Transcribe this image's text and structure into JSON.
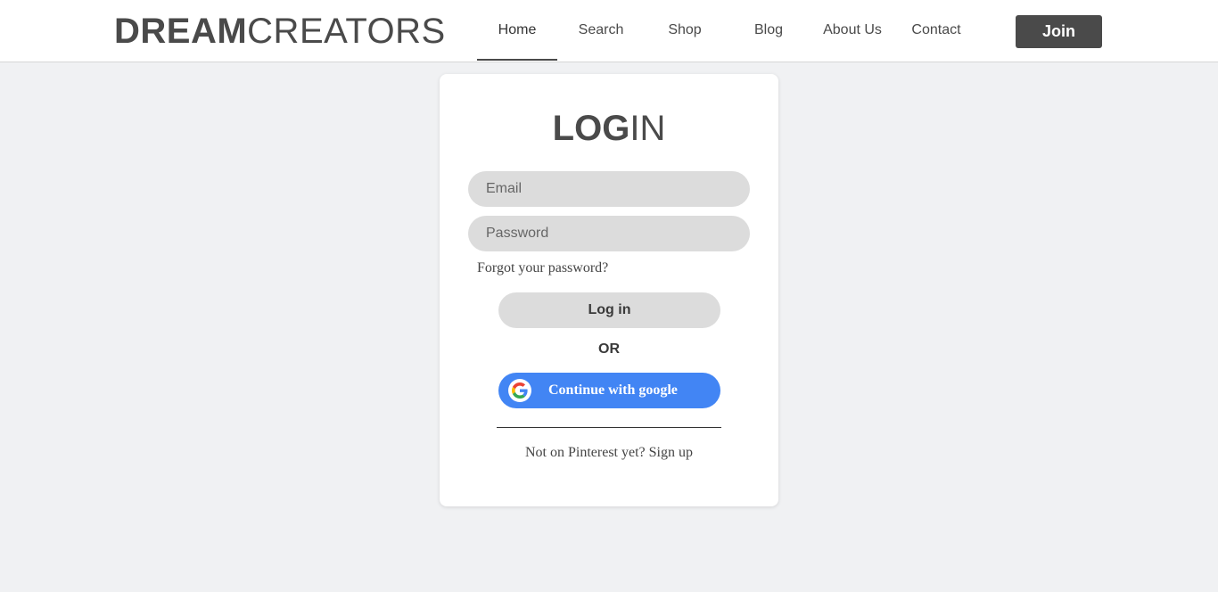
{
  "header": {
    "logo_bold": "DREAM",
    "logo_light": "CREATORS",
    "nav": [
      {
        "label": "Home",
        "active": true
      },
      {
        "label": "Search",
        "active": false
      },
      {
        "label": "Shop",
        "active": false
      },
      {
        "label": "Blog",
        "active": false
      },
      {
        "label": "About Us",
        "active": false
      },
      {
        "label": "Contact",
        "active": false
      }
    ],
    "join_label": "Join"
  },
  "login": {
    "title_bold": "LOG",
    "title_light": "IN",
    "email_placeholder": "Email",
    "email_value": "",
    "password_placeholder": "Password",
    "password_value": "",
    "forgot_label": "Forgot your password?",
    "login_button_label": "Log in",
    "or_label": "OR",
    "google_button_label": "Continue with google",
    "google_icon": "google-g-icon",
    "signup_label": "Not on Pinterest yet? Sign up"
  },
  "colors": {
    "background": "#f0f1f3",
    "text": "#4a4a4a",
    "join_button": "#4a4a4a",
    "input_fill": "#dcdcdc",
    "google_blue": "#4285f4"
  }
}
